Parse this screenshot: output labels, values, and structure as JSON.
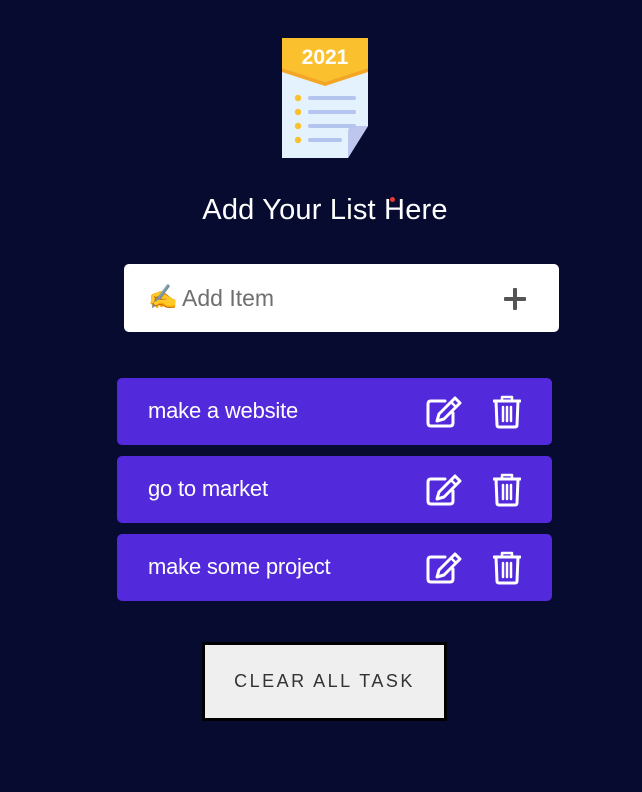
{
  "logo": {
    "year": "2021",
    "icon": "checklist-calendar-icon"
  },
  "heading": {
    "text": "Add Your List Here"
  },
  "add_item": {
    "emoji": "✍️",
    "placeholder": "Add Item",
    "value": "",
    "button_icon": "plus-icon"
  },
  "tasks": [
    {
      "label": "make a website"
    },
    {
      "label": "go to market"
    },
    {
      "label": "make some project"
    }
  ],
  "clear_button": {
    "label": "CLEAR ALL TASK"
  },
  "colors": {
    "background": "#070b30",
    "task_bg": "#5229db",
    "logo_banner": "#fbc02d",
    "logo_paper": "#e3f2fd"
  }
}
